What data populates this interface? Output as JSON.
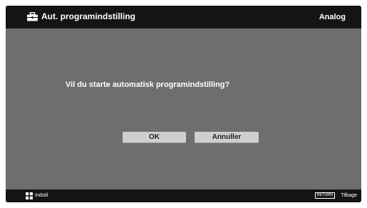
{
  "header": {
    "icon": "toolbox-icon",
    "title": "Aut. programindstilling",
    "mode": "Analog"
  },
  "dialog": {
    "question": "Vil du starte automatisk programindstilling?",
    "ok_label": "OK",
    "cancel_label": "Annuller"
  },
  "footer": {
    "left_icon": "plus-cross-icon",
    "left_label": "Indstil",
    "return_key": "RETURN",
    "return_label": "Tilbage"
  },
  "colors": {
    "background": "#6e6e6e",
    "bars": "#141414",
    "button": "#cfcfcf",
    "text": "#ffffff"
  }
}
